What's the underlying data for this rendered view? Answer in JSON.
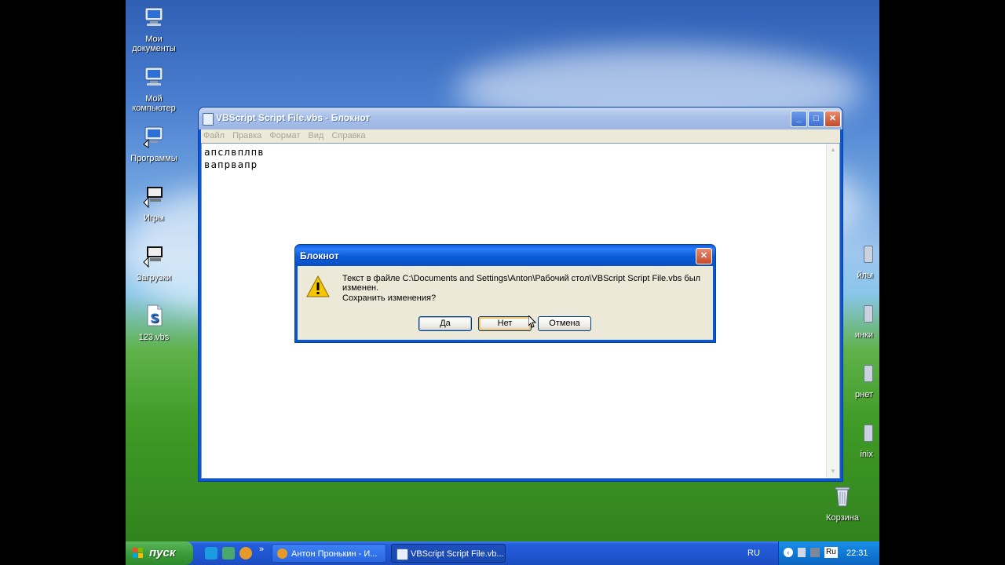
{
  "desktop": {
    "icons": [
      {
        "label": "Мои документы",
        "name": "my-documents"
      },
      {
        "label": "Мой компьютер",
        "name": "my-computer"
      },
      {
        "label": "Программы",
        "name": "programs"
      },
      {
        "label": "Игры",
        "name": "games"
      },
      {
        "label": "Загрузки",
        "name": "downloads"
      },
      {
        "label": "123.vbs",
        "name": "file-123-vbs"
      }
    ],
    "right_edge_labels": [
      "йлы",
      "инки",
      "рнет",
      "inix"
    ],
    "recycle_bin": "Корзина"
  },
  "notepad": {
    "title": "VBScript Script File.vbs - Блокнот",
    "menu": [
      "Файл",
      "Правка",
      "Формат",
      "Вид",
      "Справка"
    ],
    "lines": [
      "апслвплпв",
      "вапрвапр"
    ]
  },
  "dialog": {
    "title": "Блокнот",
    "message": "Текст в файле C:\\Documents and Settings\\Anton\\Рабочий стол\\VBScript Script File.vbs был изменен.",
    "question": "Сохранить изменения?",
    "buttons": {
      "yes": "Да",
      "no": "Нет",
      "cancel": "Отмена"
    }
  },
  "taskbar": {
    "start_label": "пуск",
    "chevron": "»",
    "tasks": [
      {
        "label": "Антон Пронькин - И...",
        "active": false
      },
      {
        "label": "VBScript Script File.vb...",
        "active": true
      }
    ],
    "tray": {
      "lang": "RU",
      "ime": "Ru",
      "clock": "22:31"
    }
  },
  "colors": {
    "titlebar_active": "#0a57d6",
    "dialog_face": "#ece9d8",
    "start_green": "#3a9a37",
    "taskbar_blue": "#245edb"
  }
}
